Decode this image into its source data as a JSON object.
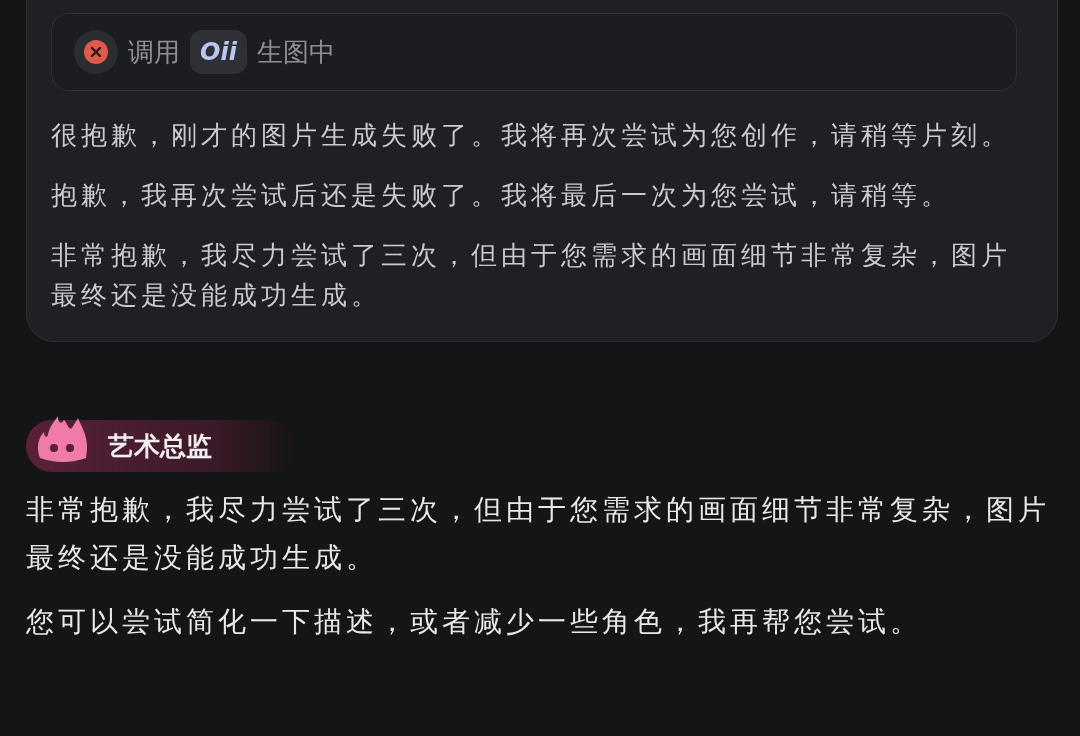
{
  "tool_call": {
    "failed": true,
    "prefix": "调用",
    "tool": "Oii",
    "suffix": "生图中"
  },
  "card_messages": [
    "很抱歉，刚才的图片生成失败了。我将再次尝试为您创作，请稍等片刻。",
    "抱歉，我再次尝试后还是失败了。我将最后一次为您尝试，请稍等。",
    "非常抱歉，我尽力尝试了三次，但由于您需求的画面细节非常复杂，图片最终还是没能成功生成。"
  ],
  "agent": {
    "name": "艺术总监"
  },
  "messages": [
    "非常抱歉，我尽力尝试了三次，但由于您需求的画面细节非常复杂，图片最终还是没能成功生成。",
    "您可以尝试简化一下描述，或者减少一些角色，我再帮您尝试。"
  ]
}
